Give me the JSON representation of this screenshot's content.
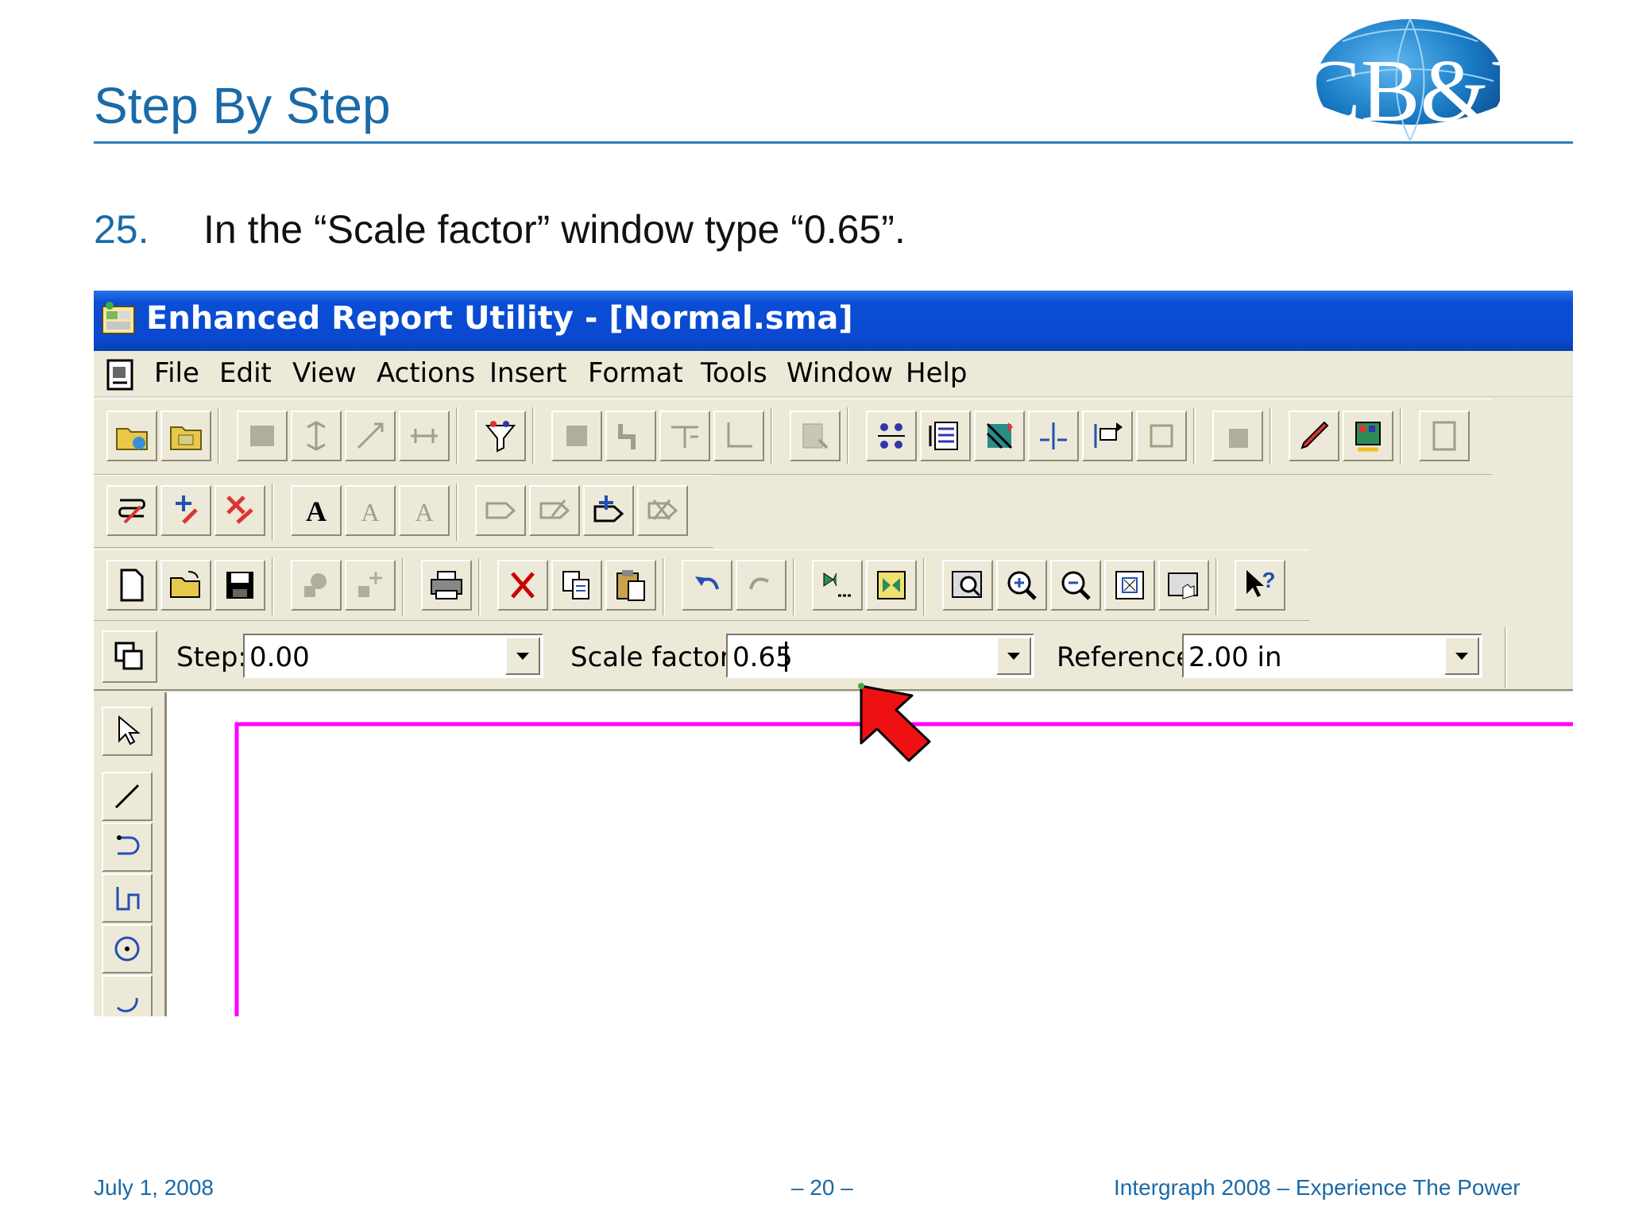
{
  "slide": {
    "title": "Step By Step",
    "step_number": "25.",
    "step_text": "In the “Scale factor” window type “0.65”.",
    "logo_text": "CB&I"
  },
  "app": {
    "window_title": "Enhanced Report Utility - [Normal.sma]",
    "menu": [
      "File",
      "Edit",
      "View",
      "Actions",
      "Insert",
      "Format",
      "Tools",
      "Window",
      "Help"
    ],
    "property_bar": {
      "step_label": "Step:",
      "step_value": "0.00",
      "scale_label": "Scale factor:",
      "scale_value": "0.65",
      "reference_label": "Reference:",
      "reference_value": "2.00 in"
    },
    "colors": {
      "drawing_line": "#ff00ff",
      "pointer_arrow": "#ff0000",
      "titlebar": "#0a48cf"
    }
  },
  "footer": {
    "date": "July 1, 2008",
    "page": "– 20 –",
    "tagline": "Intergraph 2008 – Experience The Power"
  }
}
